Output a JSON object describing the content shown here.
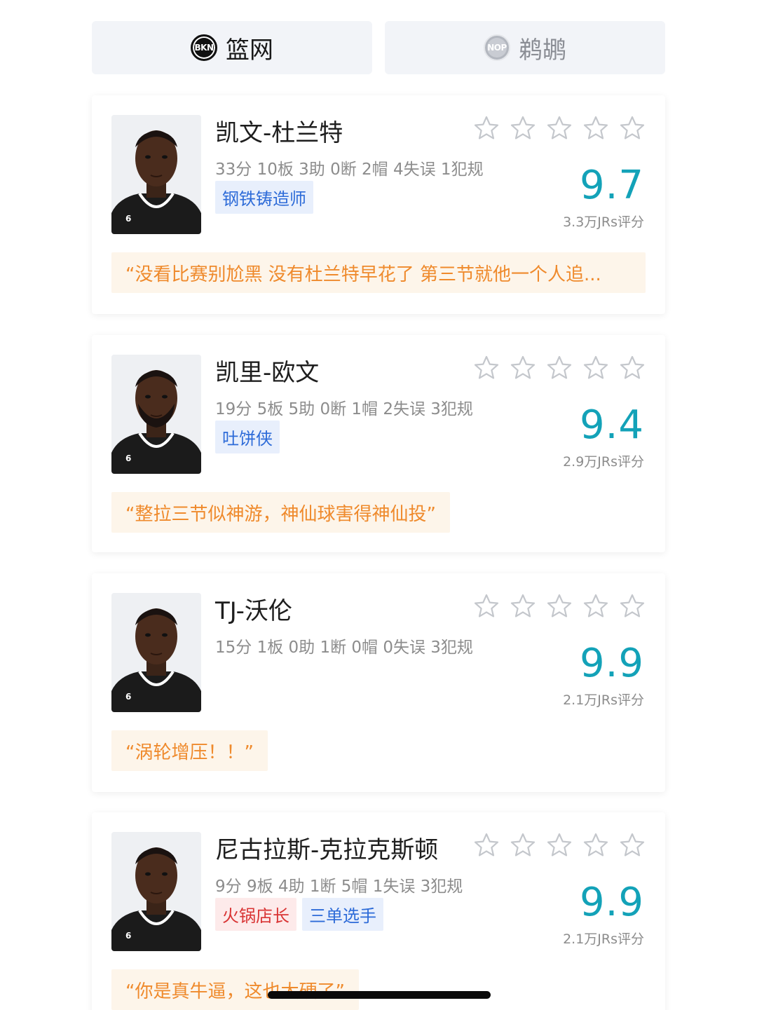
{
  "tabs": [
    {
      "label": "篮网",
      "logo_text": "BKN",
      "active": true
    },
    {
      "label": "鹈鹕",
      "logo_text": "NOP",
      "active": false
    }
  ],
  "colors": {
    "score": "#13a2b8",
    "quote_text": "#ef8a2c",
    "quote_bg": "#fdf5ea",
    "badge_blue": "#2d6bd8",
    "badge_red": "#d93434"
  },
  "players": [
    {
      "name": "凯文-杜兰特",
      "stats": "33分 10板 3助 0断 2帽 4失误 1犯规",
      "badges": [
        "钢铁铸造师"
      ],
      "score": "9.7",
      "votes": "3.3万JRs评分",
      "quote": "“没看比赛别尬黑 没有杜兰特早花了 第三节就他一个人追...",
      "stars": 5,
      "jersey_number": "6"
    },
    {
      "name": "凯里-欧文",
      "stats": "19分 5板 5助 0断 1帽 2失误 3犯规",
      "badges": [
        "吐饼侠"
      ],
      "score": "9.4",
      "votes": "2.9万JRs评分",
      "quote": "“整拉三节似神游，神仙球害得神仙投”",
      "stars": 5,
      "jersey_number": "6"
    },
    {
      "name": "TJ-沃伦",
      "stats": "15分 1板 0助 1断 0帽 0失误 3犯规",
      "badges": [],
      "score": "9.9",
      "votes": "2.1万JRs评分",
      "quote": "“涡轮增压！！”",
      "stars": 5,
      "jersey_number": "6"
    },
    {
      "name": "尼古拉斯-克拉克斯顿",
      "stats": "9分 9板 4助 1断 5帽 1失误 3犯规",
      "badges": [
        "火锅店长",
        "三单选手"
      ],
      "score": "9.9",
      "votes": "2.1万JRs评分",
      "quote": "“你是真牛逼，这也太硬了”",
      "stars": 5,
      "jersey_number": "6"
    }
  ]
}
